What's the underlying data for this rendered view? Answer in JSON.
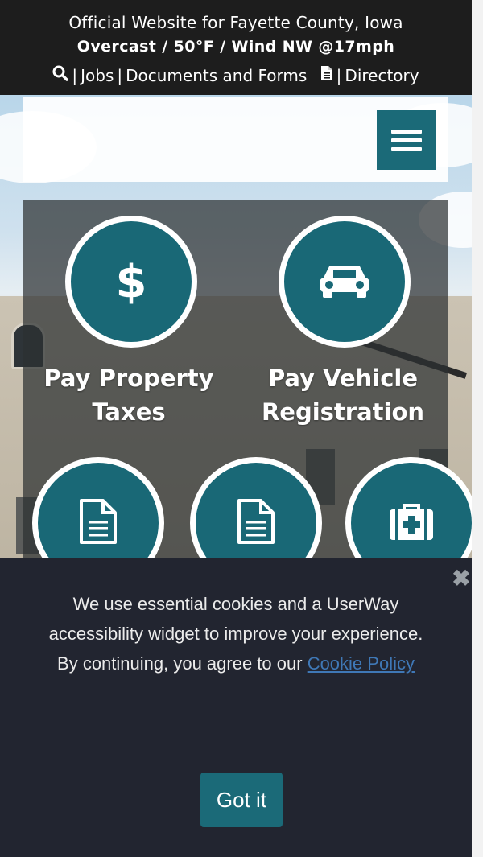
{
  "topbar": {
    "line1": "Official Website for Fayette County, Iowa",
    "weather": "Overcast / 50°F / Wind NW @17mph",
    "links": {
      "separator": "|",
      "jobs": "Jobs",
      "documents": "Documents and Forms",
      "directory": "Directory"
    },
    "icons": [
      "search-icon",
      "document-icon"
    ]
  },
  "header": {
    "menu_icon": "hamburger-menu-icon"
  },
  "tiles": [
    {
      "label_line1": "Pay Property",
      "label_line2": "Taxes",
      "icon": "dollar-icon",
      "glyph": "$"
    },
    {
      "label_line1": "Pay Vehicle",
      "label_line2": "Registration",
      "icon": "car-icon"
    },
    {
      "icon": "document-icon"
    },
    {
      "icon": "document-icon"
    },
    {
      "icon": "medical-kit-icon"
    }
  ],
  "cookie": {
    "message_line": "We use essential cookies and a UserWay accessibility widget to improve your experience.",
    "continue_text": "By continuing, you agree to our",
    "policy_link": "Cookie Policy",
    "button": "Got it",
    "close_glyph": "✖"
  },
  "colors": {
    "topbar_bg": "#1d1d1d",
    "accent_teal": "#196876",
    "cookie_bg": "#222530",
    "link_blue": "#3f78b6"
  }
}
